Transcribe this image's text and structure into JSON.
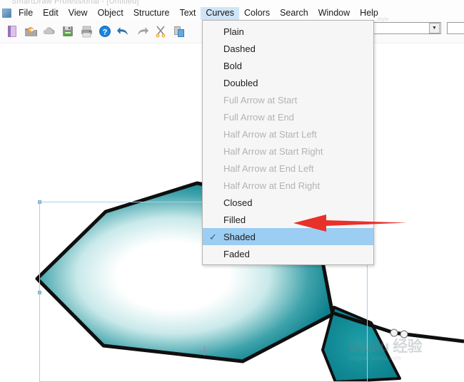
{
  "window": {
    "title": "SmartDraw Professional - [Untitled]"
  },
  "menubar": {
    "items": [
      {
        "label": "File",
        "accel": "F",
        "active": false
      },
      {
        "label": "Edit",
        "accel": "E",
        "active": false
      },
      {
        "label": "View",
        "accel": "V",
        "active": false
      },
      {
        "label": "Object",
        "accel": "O",
        "active": false
      },
      {
        "label": "Structure",
        "accel": "S",
        "active": false
      },
      {
        "label": "Text",
        "accel": "x",
        "active": false
      },
      {
        "label": "Curves",
        "accel": "C",
        "active": true
      },
      {
        "label": "Colors",
        "accel": "l",
        "active": false
      },
      {
        "label": "Search",
        "accel": "r",
        "active": false
      },
      {
        "label": "Window",
        "accel": "W",
        "active": false
      },
      {
        "label": "Help",
        "accel": "H",
        "active": false
      }
    ]
  },
  "toolbar": {
    "buttons": [
      {
        "name": "new-document-icon",
        "title": "New"
      },
      {
        "name": "open-folder-icon",
        "title": "Open"
      },
      {
        "name": "cloud-icon",
        "title": "Cloud"
      },
      {
        "name": "save-floppy-icon",
        "title": "Save"
      },
      {
        "name": "print-icon",
        "title": "Print"
      },
      {
        "name": "help-question-icon",
        "title": "Help"
      },
      {
        "name": "undo-arrow-icon",
        "title": "Undo"
      },
      {
        "name": "redo-arrow-icon",
        "title": "Redo"
      },
      {
        "name": "cut-scissors-icon",
        "title": "Cut"
      },
      {
        "name": "copy-pages-icon",
        "title": "Copy"
      }
    ],
    "combo_value": "",
    "ghost_label": "Style"
  },
  "curves_menu": {
    "items": [
      {
        "label": "Plain",
        "state": "normal",
        "checked": false
      },
      {
        "label": "Dashed",
        "state": "normal",
        "checked": false
      },
      {
        "label": "Bold",
        "state": "normal",
        "checked": false
      },
      {
        "label": "Doubled",
        "state": "normal",
        "checked": false
      },
      {
        "label": "Full Arrow at Start",
        "state": "disabled",
        "checked": false
      },
      {
        "label": "Full Arrow at End",
        "state": "disabled",
        "checked": false
      },
      {
        "label": "Half Arrow at Start Left",
        "state": "disabled",
        "checked": false
      },
      {
        "label": "Half Arrow at Start Right",
        "state": "disabled",
        "checked": false
      },
      {
        "label": "Half Arrow at End Left",
        "state": "disabled",
        "checked": false
      },
      {
        "label": "Half Arrow at End Right",
        "state": "disabled",
        "checked": false
      },
      {
        "label": "Closed",
        "state": "normal",
        "checked": false
      },
      {
        "label": "Filled",
        "state": "normal",
        "checked": false
      },
      {
        "label": "Shaded",
        "state": "selected",
        "checked": true
      },
      {
        "label": "Faded",
        "state": "normal",
        "checked": false
      }
    ],
    "checkmark_glyph": "✓"
  },
  "canvas": {
    "shape_name": "hexagon",
    "fill_center_color": "#ffffff",
    "fill_edge_color": "#0b7f8c",
    "stroke_color": "#101010",
    "selection_color": "#a8cfe8",
    "line_shape_name": "polyline"
  },
  "annotation": {
    "arrow_color": "#e8312a",
    "points_to": "Shaded"
  },
  "watermark": {
    "main": "Baidu 经验",
    "sub": "jingyan.baidu.com"
  }
}
